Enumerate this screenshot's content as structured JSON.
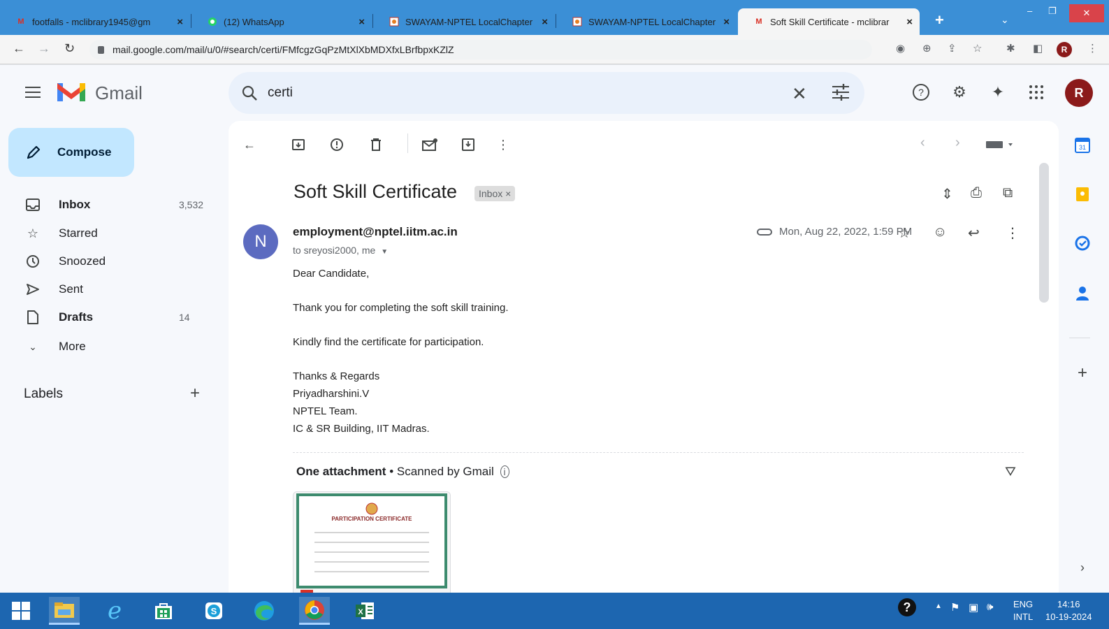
{
  "browser": {
    "tabs": [
      {
        "title": "footfalls - mclibrary1945@gm",
        "active": false
      },
      {
        "title": "(12) WhatsApp",
        "active": false
      },
      {
        "title": "SWAYAM-NPTEL LocalChapter",
        "active": false
      },
      {
        "title": "SWAYAM-NPTEL LocalChapter",
        "active": false
      },
      {
        "title": "Soft Skill Certificate - mclibrar",
        "active": true
      }
    ],
    "new_tab": "+",
    "url": "mail.google.com/mail/u/0/#search/certi/FMfcgzGqPzMtXlXbMDXfxLBrfbpxKZlZ",
    "profile_initial": "R"
  },
  "gmail": {
    "logo_text": "Gmail",
    "search_value": "certi",
    "avatar_initial": "R",
    "compose_label": "Compose",
    "nav": [
      {
        "label": "Inbox",
        "count": "3,532",
        "bold": true,
        "icon": "inbox-icon"
      },
      {
        "label": "Starred",
        "count": "",
        "bold": false,
        "icon": "star-icon"
      },
      {
        "label": "Snoozed",
        "count": "",
        "bold": false,
        "icon": "clock-icon"
      },
      {
        "label": "Sent",
        "count": "",
        "bold": false,
        "icon": "send-icon"
      },
      {
        "label": "Drafts",
        "count": "14",
        "bold": true,
        "icon": "draft-icon"
      },
      {
        "label": "More",
        "count": "",
        "bold": false,
        "icon": "chevron-down-icon"
      }
    ],
    "labels_heading": "Labels",
    "email": {
      "subject": "Soft Skill Certificate",
      "label_chip": "Inbox ×",
      "sender_initial": "N",
      "sender": "employment@nptel.iitm.ac.in",
      "recipients": "to sreyosi2000, me",
      "date": "Mon, Aug 22, 2022, 1:59 PM",
      "body": [
        "Dear Candidate,",
        "Thank you for completing the soft skill training.",
        "Kindly find the certificate for participation.",
        "Thanks & Regards",
        "Priyadharshini.V",
        "NPTEL Team.",
        "IC & SR Building, IIT Madras."
      ],
      "attachment_title": "One attachment",
      "attachment_scan": "Scanned by Gmail",
      "certificate_heading": "PARTICIPATION CERTIFICATE"
    }
  },
  "taskbar": {
    "lang_top": "ENG",
    "lang_bottom": "INTL",
    "time": "14:16",
    "date": "10-19-2024"
  },
  "colors": {
    "tab_strip": "#3b8fd6",
    "compose": "#c2e7ff",
    "search_bg": "#eaf1fb",
    "taskbar": "#1d66b0",
    "avatar": "#8b1a1a",
    "sender_avatar": "#5c6bc0"
  }
}
